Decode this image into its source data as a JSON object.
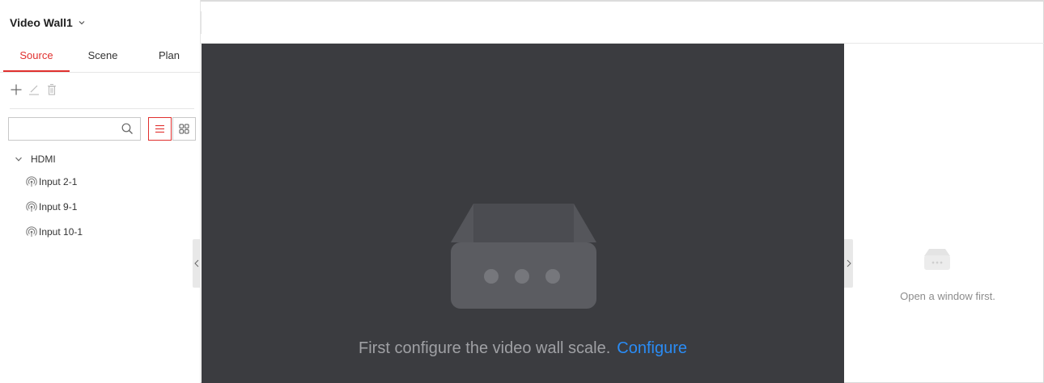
{
  "header": {
    "wall_name": "Video Wall1",
    "wall_chevron_icon": "chevron-down-icon"
  },
  "tabs": [
    {
      "label": "Source",
      "active": true
    },
    {
      "label": "Scene",
      "active": false
    },
    {
      "label": "Plan",
      "active": false
    }
  ],
  "toolbar": {
    "icons": [
      "add-icon",
      "edit-icon",
      "delete-icon"
    ]
  },
  "search": {
    "value": "",
    "placeholder": "",
    "icon": "search-icon"
  },
  "view_modes": {
    "list_icon": "list-view-icon",
    "grid_icon": "grid-view-icon",
    "selected": "list"
  },
  "tree": {
    "group": {
      "label": "HDMI",
      "expanded": true
    },
    "items": [
      {
        "label": "Input 2-1",
        "icon": "signal-icon"
      },
      {
        "label": "Input 9-1",
        "icon": "signal-icon"
      },
      {
        "label": "Input 10-1",
        "icon": "signal-icon"
      }
    ]
  },
  "canvas": {
    "message": "First configure the video wall scale.",
    "link_label": "Configure"
  },
  "right_panel": {
    "message": "Open a window first."
  },
  "colors": {
    "accent": "#e0302e",
    "link": "#2a8cf5",
    "canvas_bg": "#3b3c40"
  }
}
